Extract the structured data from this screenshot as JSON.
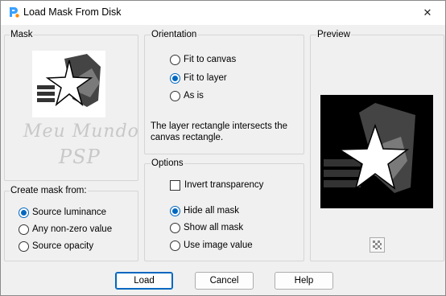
{
  "window": {
    "title": "Load Mask From Disk",
    "close_glyph": "✕",
    "app_icon": "paintshop-pro-icon"
  },
  "mask": {
    "label": "Mask",
    "watermark_line1": "Meu Mundo",
    "watermark_line2": "PSP"
  },
  "create_mask": {
    "label": "Create mask from:",
    "options": [
      {
        "label": "Source luminance",
        "selected": true
      },
      {
        "label": "Any non-zero value",
        "selected": false
      },
      {
        "label": "Source opacity",
        "selected": false
      }
    ]
  },
  "orientation": {
    "label": "Orientation",
    "options": [
      {
        "label": "Fit to canvas",
        "selected": false
      },
      {
        "label": "Fit to layer",
        "selected": true
      },
      {
        "label": "As is",
        "selected": false
      }
    ],
    "message": "The layer rectangle intersects the canvas rectangle."
  },
  "options": {
    "label": "Options",
    "invert_transparency": {
      "label": "Invert transparency",
      "checked": false
    },
    "mask_options": [
      {
        "label": "Hide all mask",
        "selected": true
      },
      {
        "label": "Show all mask",
        "selected": false
      },
      {
        "label": "Use image value",
        "selected": false
      }
    ]
  },
  "preview": {
    "label": "Preview",
    "toggle_icon": "checkerboard-icon"
  },
  "buttons": {
    "load": "Load",
    "cancel": "Cancel",
    "help": "Help"
  },
  "colors": {
    "accent": "#0067c0",
    "dialog_bg": "#f0f0f0",
    "group_border": "#d5d5d5"
  }
}
